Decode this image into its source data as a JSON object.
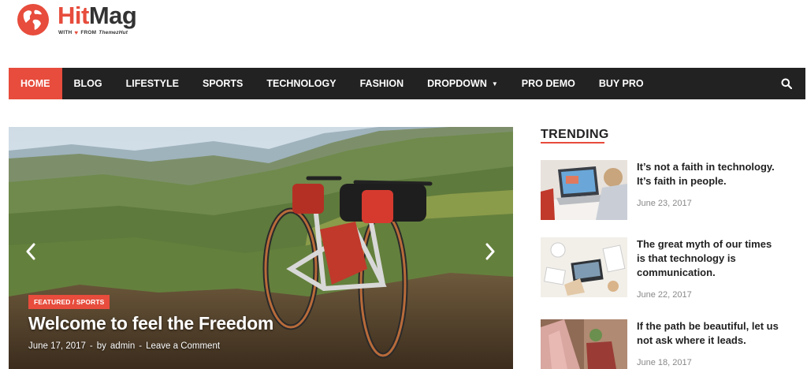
{
  "header": {
    "site_title_hit": "Hit",
    "site_title_rest": "Mag",
    "tagline_with": "WITH",
    "tagline_from": "FROM",
    "tagline_brand": "ThemezHut"
  },
  "nav": {
    "items": [
      {
        "label": "HOME"
      },
      {
        "label": "BLOG"
      },
      {
        "label": "LIFESTYLE"
      },
      {
        "label": "SPORTS"
      },
      {
        "label": "TECHNOLOGY"
      },
      {
        "label": "FASHION"
      },
      {
        "label": "DROPDOWN"
      },
      {
        "label": "PRO DEMO"
      },
      {
        "label": "BUY PRO"
      }
    ],
    "search_icon": "search-icon"
  },
  "slider": {
    "category": "FEATURED / SPORTS",
    "title": "Welcome to feel the Freedom",
    "date": "June 17, 2017",
    "sep1": "-",
    "by": "by",
    "author": "admin",
    "sep2": "-",
    "comment_link": "Leave a Comment"
  },
  "sidebar": {
    "heading": "TRENDING",
    "items": [
      {
        "title": "It’s not a faith in technology. It’s faith in people.",
        "date": "June 23, 2017"
      },
      {
        "title": "The great myth of our times is that technology is communication.",
        "date": "June 22, 2017"
      },
      {
        "title": "If the path be beautiful, let us not ask where it leads.",
        "date": "June 18, 2017"
      }
    ]
  },
  "colors": {
    "accent": "#e74c3c",
    "nav_bg": "#222222"
  }
}
